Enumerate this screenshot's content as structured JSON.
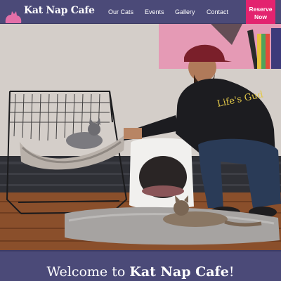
{
  "brand": {
    "name": "Kat Nap Cafe",
    "logo_icon": "sleeping-cat-icon",
    "accent": "#e3236f",
    "nav_bg": "#4b4a78",
    "logo_cat_color": "#e36fa8"
  },
  "nav": {
    "links": [
      "Our Cats",
      "Events",
      "Gallery",
      "Contact"
    ],
    "cta": {
      "line1": "Reserve",
      "line2": "Now"
    }
  },
  "hero": {
    "image": "Man in cap and black hoodie petting a grey cat in a wire hammock chair while a tabby cat lies on a grey rug"
  },
  "welcome": {
    "prefix": "Welcome to ",
    "brand": "Kat Nap Cafe",
    "suffix": "!"
  }
}
